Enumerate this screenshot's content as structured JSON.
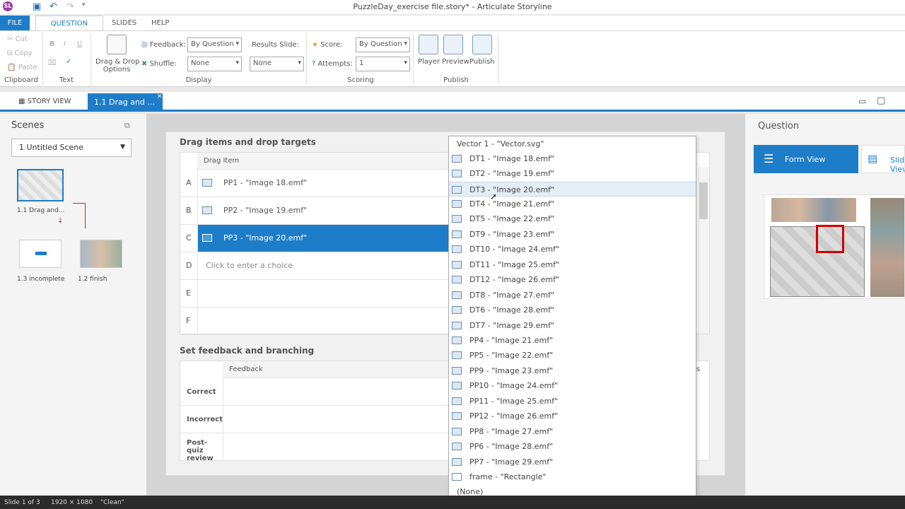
{
  "titlebar": {
    "title": "PuzzleDay_exercise file.story* - Articulate Storyline",
    "logo": "SL"
  },
  "ribbon_tabs": [
    "FILE",
    "QUESTION",
    "SLIDES",
    "HELP"
  ],
  "clipboard": {
    "cut": "Cut",
    "copy": "Copy",
    "paste": "Paste",
    "group": "Clipboard"
  },
  "text_group": {
    "bold": "B",
    "italic": "I",
    "underline": "U",
    "group": "Text"
  },
  "display": {
    "dragdrop": "Drag & Drop",
    "options": "Options",
    "feedback_label": "Feedback:",
    "feedback_value": "By Question",
    "shuffle_label": "Shuffle:",
    "shuffle_value": "None",
    "results_label": "Results Slide:",
    "results_value": "None",
    "group": "Display"
  },
  "scoring": {
    "score_label": "Score:",
    "score_value": "By Question",
    "attempts_label": "Attempts:",
    "attempts_value": "1",
    "group": "Scoring"
  },
  "publish": {
    "player": "Player",
    "preview": "Preview",
    "publish": "Publish",
    "group": "Publish"
  },
  "viewbar": {
    "story_view": "STORY VIEW",
    "slide_tab": "1.1 Drag and ..."
  },
  "scenes": {
    "header": "Scenes",
    "selected": "1 Untitled Scene",
    "thumb1": "1.1 Drag and...",
    "thumb2": "1.3 incomplete",
    "thumb3": "1.2 finish"
  },
  "drag": {
    "header": "Drag items and drop targets",
    "col_item": "Drag Item",
    "rows": [
      {
        "letter": "A",
        "value": "PP1 - \"Image 18.emf\""
      },
      {
        "letter": "B",
        "value": "PP2 - \"Image 19.emf\""
      },
      {
        "letter": "C",
        "value": "PP3 - \"Image 20.emf\""
      },
      {
        "letter": "D",
        "value": "Click to enter a choice"
      },
      {
        "letter": "E",
        "value": ""
      },
      {
        "letter": "F",
        "value": ""
      }
    ]
  },
  "feedback": {
    "header": "Set feedback and branching",
    "col": "Feedback",
    "col_points": "ts",
    "rows": [
      "Correct",
      "Incorrect",
      "Post-quiz review"
    ]
  },
  "question": {
    "title": "Question",
    "form_view": "Form View",
    "slide_view": "Slide View"
  },
  "dropdown": {
    "items": [
      "Vector 1 - \"Vector.svg\"",
      "DT1 - \"Image 18.emf\"",
      "DT2 - \"Image 19.emf\"",
      "DT3 - \"Image 20.emf\"",
      "DT4 - \"Image 21.emf\"",
      "DT5 - \"Image 22.emf\"",
      "DT9 - \"Image 23.emf\"",
      "DT10 - \"Image 24.emf\"",
      "DT11 - \"Image 25.emf\"",
      "DT12 - \"Image 26.emf\"",
      "DT8 - \"Image 27.emf\"",
      "DT6 - \"Image 28.emf\"",
      "DT7 - \"Image 29.emf\"",
      "PP4 - \"Image 21.emf\"",
      "PP5 - \"Image 22.emf\"",
      "PP9 - \"Image 23.emf\"",
      "PP10 - \"Image 24.emf\"",
      "PP11 - \"Image 25.emf\"",
      "PP12 - \"Image 26.emf\"",
      "PP8 - \"Image 27.emf\"",
      "PP6 - \"Image 28.emf\"",
      "PP7 - \"Image 29.emf\"",
      "frame - \"Rectangle\"",
      "(None)"
    ],
    "highlighted": "DT3 - \"Image 20.emf\""
  },
  "status": {
    "slide": "Slide 1 of 3",
    "size": "1920 × 1080",
    "theme": "\"Clean\""
  },
  "colors": {
    "accent": "#1e7dc8",
    "highlight": "#e4eef6"
  }
}
